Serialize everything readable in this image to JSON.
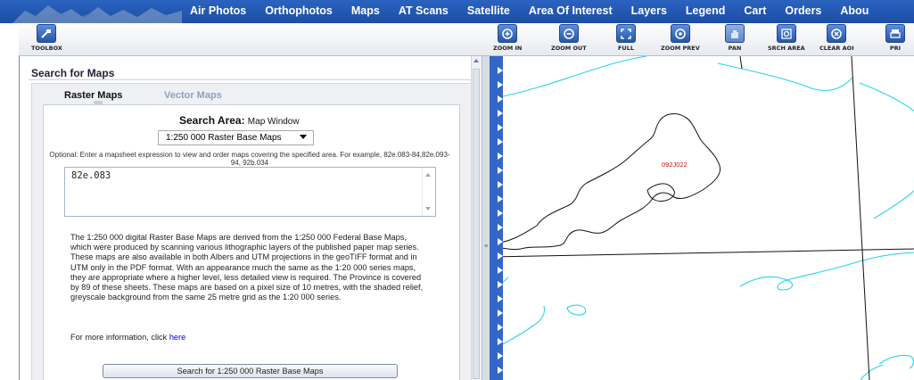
{
  "nav": {
    "items": [
      "Air Photos",
      "Orthophotos",
      "Maps",
      "AT Scans",
      "Satellite",
      "Area Of Interest",
      "Layers",
      "Legend",
      "Cart",
      "Orders",
      "Abou"
    ]
  },
  "toolbar": {
    "toolbox_label": "TOOLBOX",
    "buttons": [
      {
        "label": "ZOOM IN",
        "icon": "zoom-in-icon"
      },
      {
        "label": "ZOOM OUT",
        "icon": "zoom-out-icon"
      },
      {
        "label": "FULL",
        "icon": "full-extent-icon"
      },
      {
        "label": "ZOOM PREV",
        "icon": "zoom-previous-icon"
      },
      {
        "label": "PAN",
        "icon": "pan-hand-icon"
      },
      {
        "label": "SRCH AREA",
        "icon": "search-area-icon"
      },
      {
        "label": "CLEAR AOI",
        "icon": "clear-aoi-icon"
      },
      {
        "label": "PRI",
        "icon": "print-icon"
      }
    ]
  },
  "panel": {
    "title": "Search for Maps",
    "tabs": [
      "Raster Maps",
      "Vector Maps"
    ],
    "search_area_label": "Search Area:",
    "search_area_value": "Map Window",
    "select_value": "1:250 000 Raster Base Maps",
    "optional_text": "Optional: Enter a mapsheet expression to view and order maps covering the specified area. For example, 82e.083-84,82e.093-94, 92b.034",
    "expression_value": "82e.083",
    "description": "The 1:250 000 digital Raster Base Maps are derived from the 1:250 000 Federal Base Maps, which were produced by scanning various lithographic layers of the published paper map series. These maps are also available in both Albers and UTM projections in the geoTIFF format and in UTM only in the PDF format. With an appearance much the same as the 1:20 000 series maps, they are appropriate where a higher level, less detailed view is required. The Province is covered by 89 of these sheets. These maps are based on a pixel size of 10 metres, with the shaded relief, greyscale background from the same 25 metre grid as the 1:20 000 series.",
    "more_info_text": "For more information, click",
    "more_info_link": "here",
    "search_button": "Search for 1:250 000 Raster Base Maps"
  },
  "map": {
    "sheet_label": "092J022",
    "water_color": "#29d3ea",
    "boundary_color": "#111111",
    "label_color": "#cc1111"
  }
}
